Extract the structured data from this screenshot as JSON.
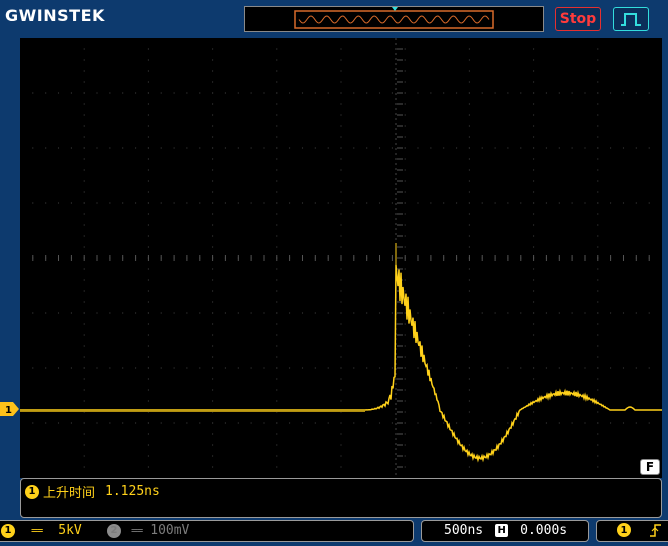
{
  "header": {
    "brand": "GWINSTEK",
    "run_state": "Stop",
    "trigger_mode_icon": "rising-pulse-icon"
  },
  "screen": {
    "trigger_position_icon": "triangle-down-icon",
    "ch1_ground_marker": "1",
    "filter_badge": "F",
    "trace_color": "#ffd11a",
    "grid_color": "#3c3c3c"
  },
  "measurement": {
    "channel": "1",
    "label": "上升时间",
    "value": "1.125ns"
  },
  "status": {
    "ch1": {
      "channel": "1",
      "coupling_symbol": "==",
      "scale": "5kV"
    },
    "ch2": {
      "channel": "2",
      "coupling_symbol": "==",
      "scale": "100mV"
    },
    "timebase": "500ns",
    "horizontal_icon": "H",
    "horizontal_position": "0.000s",
    "trigger_source": "1",
    "trigger_slope_icon": "rising-edge-icon"
  },
  "colors": {
    "ch1": "#ffd11a",
    "ch2_disabled": "#7c7c7c",
    "stop": "#ff3b3b",
    "trigger_mode": "#33dddd",
    "background": "#0d3a6e"
  }
}
